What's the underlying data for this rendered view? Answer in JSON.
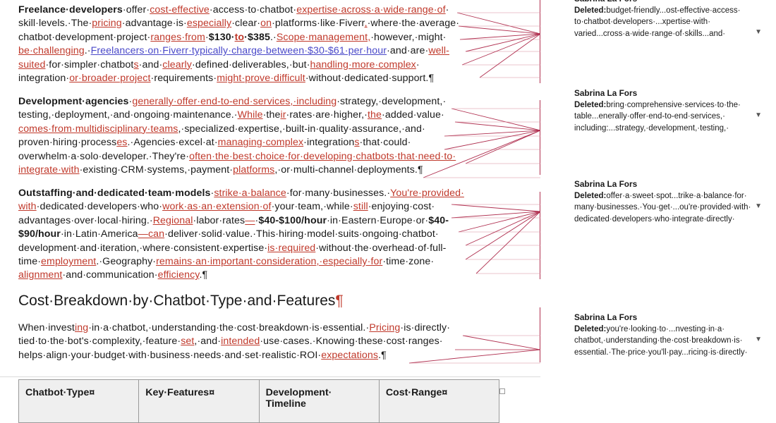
{
  "document": {
    "paragraphs": [
      {
        "id": "freelance",
        "lines": [
          [
            {
              "t": "Freelance·developers",
              "s": "b"
            },
            {
              "t": "·offer·"
            },
            {
              "t": "cost-effective",
              "s": "ins"
            },
            {
              "t": "·access·to·chatbot·"
            },
            {
              "t": "expertise·across·a·wide·range·of",
              "s": "ins"
            },
            {
              "t": "·"
            }
          ],
          [
            {
              "t": "skill·levels.·The·"
            },
            {
              "t": "pricing",
              "s": "ins"
            },
            {
              "t": "·advantage·is·"
            },
            {
              "t": "especially",
              "s": "ins"
            },
            {
              "t": "·clear·"
            },
            {
              "t": "on",
              "s": "ins"
            },
            {
              "t": "·platforms·like·Fiverr"
            },
            {
              "t": ",",
              "s": "ins"
            },
            {
              "t": "·where·the·average·"
            }
          ],
          [
            {
              "t": "chatbot·development·project·"
            },
            {
              "t": "ranges·from",
              "s": "ins"
            },
            {
              "t": "·"
            },
            {
              "t": "$130·",
              "s": "b"
            },
            {
              "t": "to",
              "s": "ins b"
            },
            {
              "t": "·$385",
              "s": "b"
            },
            {
              "t": ".·"
            },
            {
              "t": "Scope·management,",
              "s": "ins"
            },
            {
              "t": "·however,·might·"
            }
          ],
          [
            {
              "t": "be·challenging",
              "s": "ins"
            },
            {
              "t": ".·"
            },
            {
              "t": "Freelancers·on·Fiverr·typically·charge·between·$30-$61·per·hour",
              "s": "ins-blue"
            },
            {
              "t": "·and·are·"
            },
            {
              "t": "well-",
              "s": "ins"
            }
          ],
          [
            {
              "t": "suited",
              "s": "ins"
            },
            {
              "t": "·for·simpler·chatbot"
            },
            {
              "t": "s",
              "s": "ins"
            },
            {
              "t": "·and·"
            },
            {
              "t": "clearly",
              "s": "ins"
            },
            {
              "t": "·defined·deliverables,·but·"
            },
            {
              "t": "handling·more·complex",
              "s": "ins"
            },
            {
              "t": "·"
            }
          ],
          [
            {
              "t": "integration·"
            },
            {
              "t": "or·broader·project",
              "s": "ins"
            },
            {
              "t": "·requirements·"
            },
            {
              "t": "might·prove·difficult",
              "s": "ins"
            },
            {
              "t": "·without·dedicated·support.¶"
            }
          ]
        ]
      },
      {
        "id": "agencies",
        "lines": [
          [
            {
              "t": "Development·agencies",
              "s": "b"
            },
            {
              "t": "·"
            },
            {
              "t": "generally·offer·end-to-end·services,·including",
              "s": "ins"
            },
            {
              "t": "·strategy,·development,·"
            }
          ],
          [
            {
              "t": "testing,·deployment,·and·ongoing·maintenance.·"
            },
            {
              "t": "While",
              "s": "ins"
            },
            {
              "t": "·the"
            },
            {
              "t": "ir",
              "s": "ins"
            },
            {
              "t": "·rates·are·higher,·"
            },
            {
              "t": "the",
              "s": "ins"
            },
            {
              "t": "·added·value·"
            }
          ],
          [
            {
              "t": "comes·from·multidisciplinary·teams",
              "s": "ins"
            },
            {
              "t": ",·specialized·expertise,·built-in·quality·assurance,·and·"
            }
          ],
          [
            {
              "t": "proven·hiring·process"
            },
            {
              "t": "es",
              "s": "ins"
            },
            {
              "t": ".·Agencies·excel·at·"
            },
            {
              "t": "managing·complex",
              "s": "ins"
            },
            {
              "t": "·integration"
            },
            {
              "t": "s",
              "s": "ins"
            },
            {
              "t": "·that·could·"
            }
          ],
          [
            {
              "t": "overwhelm·a·solo·developer.·They're·"
            },
            {
              "t": "often·the·best·choice·for·developing·chatbots·that·need·to·",
              "s": "ins"
            }
          ],
          [
            {
              "t": "integrate·with",
              "s": "ins"
            },
            {
              "t": "·existing·CRM·systems,·payment·"
            },
            {
              "t": "platforms",
              "s": "ins"
            },
            {
              "t": ",·or·multi-channel·deployments.¶"
            }
          ]
        ]
      },
      {
        "id": "outstaffing",
        "lines": [
          [
            {
              "t": "Outstaffing·and·dedicated·team·models",
              "s": "b"
            },
            {
              "t": "·"
            },
            {
              "t": "strike·a·balance",
              "s": "ins"
            },
            {
              "t": "·for·many·businesses.·"
            },
            {
              "t": "You're·provided·",
              "s": "ins"
            }
          ],
          [
            {
              "t": "with",
              "s": "ins"
            },
            {
              "t": "·dedicated·developers·who·"
            },
            {
              "t": "work·as·an·extension·of",
              "s": "ins"
            },
            {
              "t": "·your·team,·while·"
            },
            {
              "t": "still",
              "s": "ins"
            },
            {
              "t": "·enjoying·cost·"
            }
          ],
          [
            {
              "t": "advantages·over·local·hiring.·"
            },
            {
              "t": "Regional",
              "s": "ins"
            },
            {
              "t": "·labor·rates"
            },
            {
              "t": "—",
              "s": "ins"
            },
            {
              "t": "·"
            },
            {
              "t": "$40-$100/hour",
              "s": "b"
            },
            {
              "t": "·in·Eastern·Europe·or·"
            },
            {
              "t": "$40-",
              "s": "b"
            }
          ],
          [
            {
              "t": "$90/hour",
              "s": "b"
            },
            {
              "t": "·in·Latin·America"
            },
            {
              "t": "—can",
              "s": "ins"
            },
            {
              "t": "·deliver·solid·value.·This·hiring·model·suits·ongoing·chatbot·"
            }
          ],
          [
            {
              "t": "development·and·iteration,·where·consistent·expertise·"
            },
            {
              "t": "is·required",
              "s": "ins"
            },
            {
              "t": "·without·the·overhead·of·full-"
            }
          ],
          [
            {
              "t": "time·"
            },
            {
              "t": "employment",
              "s": "ins"
            },
            {
              "t": ".·Geography·"
            },
            {
              "t": "remains·an·important·consideration,·especially·for",
              "s": "ins"
            },
            {
              "t": "·time·zone·"
            }
          ],
          [
            {
              "t": "alignment",
              "s": "ins"
            },
            {
              "t": "·and·communication·"
            },
            {
              "t": "efficiency",
              "s": "ins"
            },
            {
              "t": ".¶"
            }
          ]
        ]
      },
      {
        "id": "intro",
        "lines": [
          [
            {
              "t": "When·invest"
            },
            {
              "t": "ing",
              "s": "ins"
            },
            {
              "t": "·in·a·chatbot,·understanding·the·cost·breakdown·is·essential.·"
            },
            {
              "t": "Pricing",
              "s": "ins"
            },
            {
              "t": "·is·directly·"
            }
          ],
          [
            {
              "t": "tied·to·the·bot's·complexity,·feature·"
            },
            {
              "t": "set",
              "s": "ins"
            },
            {
              "t": ",·and·"
            },
            {
              "t": "intended",
              "s": "ins"
            },
            {
              "t": "·use·cases.·Knowing·these·cost·ranges·"
            }
          ],
          [
            {
              "t": "helps·align·your·budget·with·business·needs·and·set·realistic·ROI·"
            },
            {
              "t": "expectations",
              "s": "ins"
            },
            {
              "t": ".¶"
            }
          ]
        ]
      }
    ],
    "heading": "Cost·Breakdown·by·Chatbot·Type·and·Features",
    "heading_mark": "¶",
    "table_headers": [
      "Chatbot·Type¤",
      "Key·Features¤",
      "Development·",
      "Cost·Range¤"
    ],
    "table_header_line2": "Timeline"
  },
  "comments": [
    {
      "author": "Sabrina La Fors",
      "label": "Deleted:",
      "lines": [
        "budget-friendly...ost-effective·access·",
        "to·chatbot·developers·...xpertise·with·",
        "varied...cross·a·wide·range·of·skills...and·"
      ]
    },
    {
      "author": "Sabrina La Fors",
      "label": "Deleted:",
      "lines": [
        "bring·comprehensive·services·to·the·",
        "table...enerally·offer·end-to-end·services,·",
        "including:...strategy,·development,·testing,·"
      ]
    },
    {
      "author": "Sabrina La Fors",
      "label": "Deleted:",
      "lines": [
        "offer·a·sweet·spot...trike·a·balance·for·",
        "many·businesses.·You·get·...ou're·provided·with·",
        "dedicated·developers·who·integrate·directly·"
      ]
    },
    {
      "author": "Sabrina La Fors",
      "label": "Deleted:",
      "lines": [
        "you're·looking·to·...nvesting·in·a·",
        "chatbot,·understanding·the·cost·breakdown·is·",
        "essential.·The·price·you'll·pay...ricing·is·directly·"
      ]
    }
  ],
  "colors": {
    "insert": "#c0392b",
    "insert_alt": "#4a49c9",
    "change_bar": "#b03050"
  }
}
